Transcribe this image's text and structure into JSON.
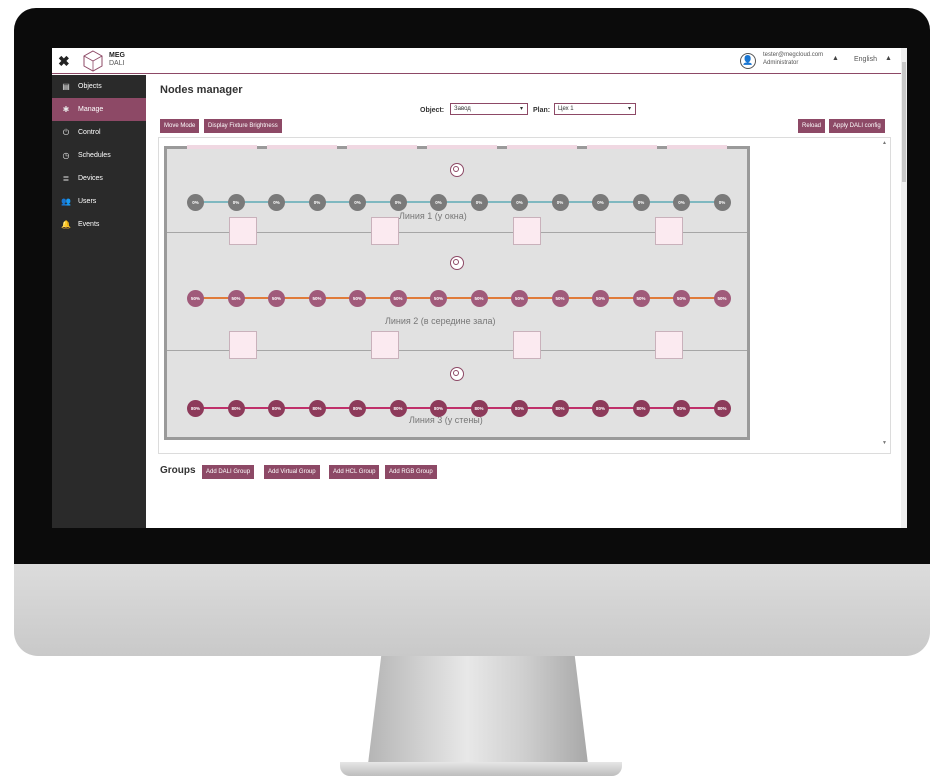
{
  "app": {
    "logo_line1": "MEG",
    "logo_line2": "DALI",
    "user_email": "tester@megcloud.com",
    "user_role": "Administrator",
    "language": "English"
  },
  "sidebar": {
    "items": [
      {
        "label": "Objects",
        "icon": "building-icon"
      },
      {
        "label": "Manage",
        "icon": "gear-icon"
      },
      {
        "label": "Control",
        "icon": "power-icon"
      },
      {
        "label": "Schedules",
        "icon": "clock-icon"
      },
      {
        "label": "Devices",
        "icon": "server-icon"
      },
      {
        "label": "Users",
        "icon": "users-icon"
      },
      {
        "label": "Events",
        "icon": "bell-icon"
      }
    ],
    "active": "Manage"
  },
  "main": {
    "title": "Nodes manager",
    "object_label": "Object:",
    "object_value": "Завод",
    "plan_label": "Plan:",
    "plan_value": "Цех 1",
    "buttons": {
      "move_mode": "Move Mode",
      "display_brightness": "Display Fixture Brightness",
      "reload": "Reload",
      "apply": "Apply DALI config"
    },
    "lines": [
      {
        "label": "Линия 1 (у окна)",
        "level": "0%",
        "node_color": "#7a7a7a",
        "line_color": "#7fb8c0"
      },
      {
        "label": "Линия 2 (в середине зала)",
        "level": "50%",
        "node_color": "#a05a7a",
        "line_color": "#e07b3a"
      },
      {
        "label": "Линия 3 (у стены)",
        "level": "80%",
        "node_color": "#8d3a5a",
        "line_color": "#c0306a"
      }
    ],
    "groups_title": "Groups",
    "group_buttons": [
      "Add DALI Group",
      "Add Virtual Group",
      "Add HCL Group",
      "Add RGB Group"
    ]
  },
  "colors": {
    "accent": "#8d4966",
    "sidebar_bg": "#2a2a2a"
  }
}
